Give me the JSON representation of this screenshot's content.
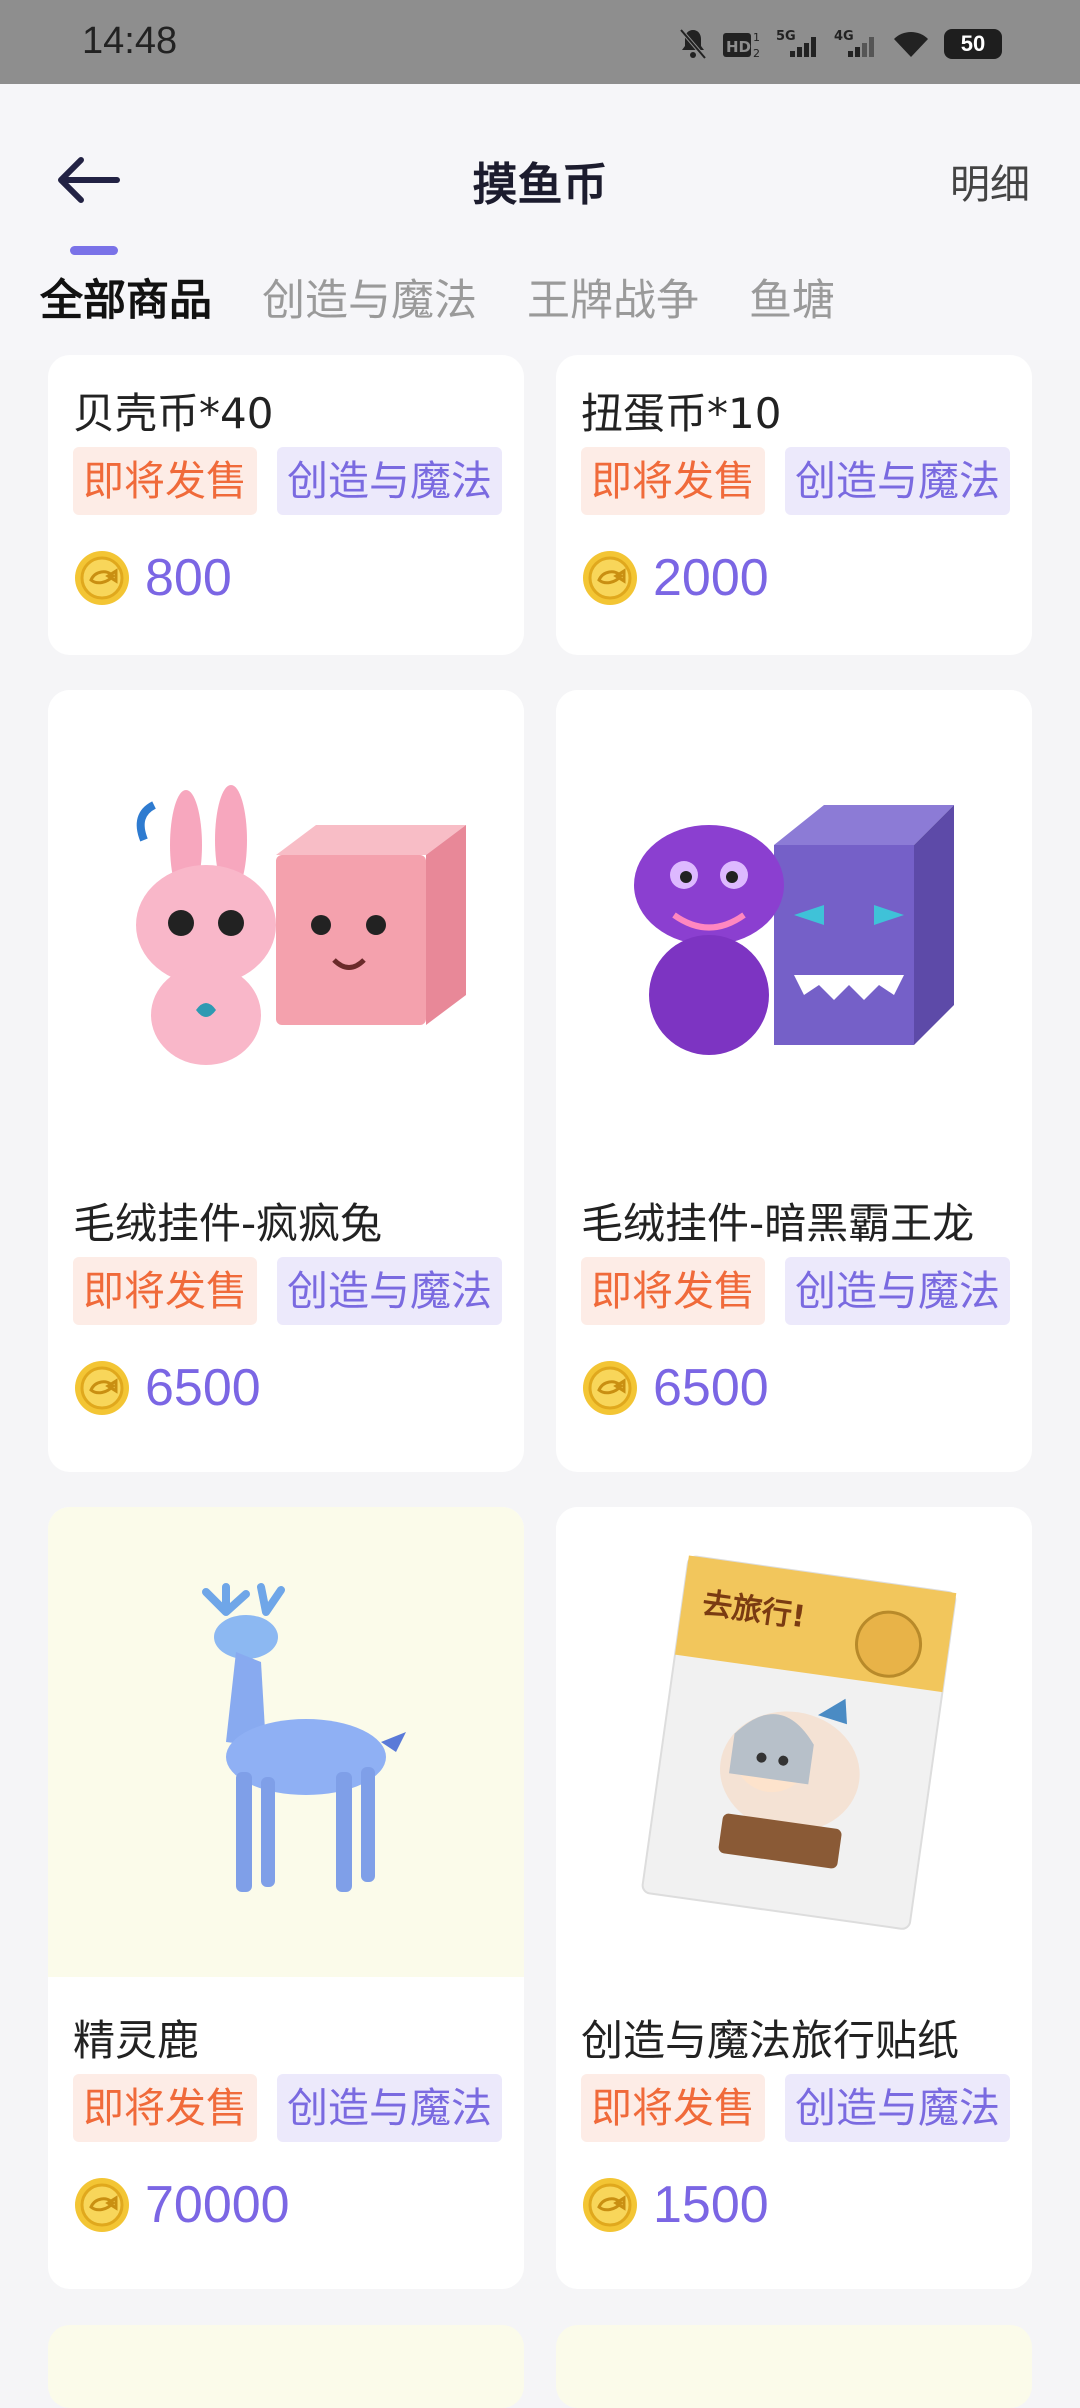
{
  "status": {
    "time": "14:48",
    "battery": "50"
  },
  "header": {
    "title": "摸鱼币",
    "detail": "明细"
  },
  "tabs": [
    "全部商品",
    "创造与魔法",
    "王牌战争",
    "鱼塘"
  ],
  "products": [
    {
      "name": "贝壳币*40",
      "tag_sale": "即将发售",
      "tag_cat": "创造与魔法",
      "price": "800",
      "image": "none"
    },
    {
      "name": "扭蛋币*10",
      "tag_sale": "即将发售",
      "tag_cat": "创造与魔法",
      "price": "2000",
      "image": "none"
    },
    {
      "name": "毛绒挂件-疯疯兔",
      "tag_sale": "即将发售",
      "tag_cat": "创造与魔法",
      "price": "6500",
      "image": "pink-bunny-plush"
    },
    {
      "name": "毛绒挂件-暗黑霸王龙",
      "tag_sale": "即将发售",
      "tag_cat": "创造与魔法",
      "price": "6500",
      "image": "purple-dino-plush"
    },
    {
      "name": "精灵鹿",
      "tag_sale": "即将发售",
      "tag_cat": "创造与魔法",
      "price": "70000",
      "image": "spirit-deer"
    },
    {
      "name": "创造与魔法旅行贴纸",
      "tag_sale": "即将发售",
      "tag_cat": "创造与魔法",
      "price": "1500",
      "image": "travel-sticker-pack"
    }
  ],
  "colors": {
    "accent": "#7b66e4",
    "sale": "#f06a3a",
    "status_bar": "#8e8e8e"
  }
}
